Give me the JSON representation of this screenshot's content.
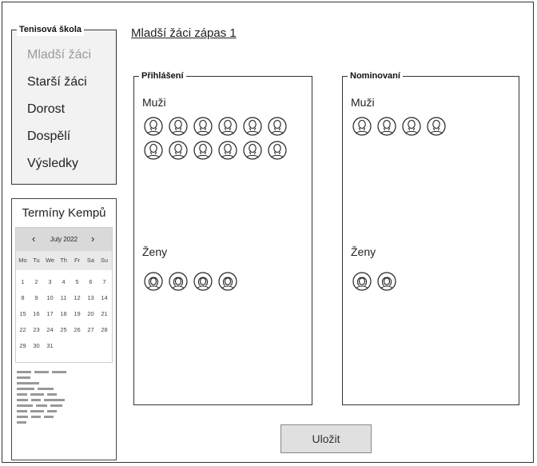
{
  "nav": {
    "legend": "Tenisová škola",
    "items": [
      {
        "label": "Mladší žáci",
        "active": true
      },
      {
        "label": "Starší žáci",
        "active": false
      },
      {
        "label": "Dorost",
        "active": false
      },
      {
        "label": "Dospělí",
        "active": false
      },
      {
        "label": "Výsledky",
        "active": false
      }
    ]
  },
  "camps": {
    "title": "Termíny Kempů",
    "calendar": {
      "month": "July 2022",
      "prev": "‹",
      "next": "›",
      "weekdays": [
        "Mo",
        "Tu",
        "We",
        "Th",
        "Fr",
        "Sa",
        "Su"
      ],
      "weeks": [
        [
          "1",
          "2",
          "3",
          "4",
          "5",
          "6",
          "7"
        ],
        [
          "8",
          "9",
          "10",
          "11",
          "12",
          "13",
          "14"
        ],
        [
          "15",
          "16",
          "17",
          "18",
          "19",
          "20",
          "21"
        ],
        [
          "22",
          "23",
          "24",
          "25",
          "26",
          "27",
          "28"
        ],
        [
          "29",
          "30",
          "31",
          "",
          "",
          "",
          ""
        ]
      ]
    }
  },
  "match": {
    "title": "Mladší žáci zápas 1"
  },
  "registered": {
    "legend": "Přihlášení",
    "men_label": "Muži",
    "men_count": 12,
    "women_label": "Ženy",
    "women_count": 4
  },
  "nominated": {
    "legend": "Nominovaní",
    "men_label": "Muži",
    "men_count": 4,
    "women_label": "Ženy",
    "women_count": 2
  },
  "save_label": "Uložit",
  "icons": {
    "male": "male-user-icon",
    "female": "female-user-icon"
  }
}
